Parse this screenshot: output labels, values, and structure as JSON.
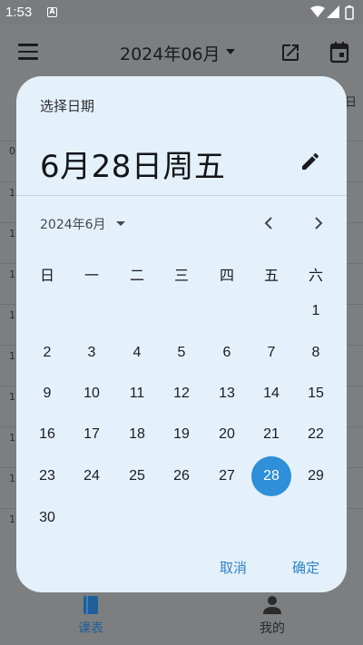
{
  "status_bar": {
    "time": "1:53",
    "app_badge": "A"
  },
  "app_bar": {
    "title": "2024年06月"
  },
  "background": {
    "side_text": "日",
    "row_numbers": [
      "0",
      "1",
      "1",
      "1",
      "1",
      "1",
      "1",
      "1",
      "1",
      "1"
    ]
  },
  "bottom_nav": {
    "schedule_label": "课表",
    "mine_label": "我的"
  },
  "dialog": {
    "label": "选择日期",
    "headline": "6月28日周五",
    "month_label": "2024年6月",
    "weekdays": [
      "日",
      "一",
      "二",
      "三",
      "四",
      "五",
      "六"
    ],
    "days": [
      "1",
      "2",
      "3",
      "4",
      "5",
      "6",
      "7",
      "8",
      "9",
      "10",
      "11",
      "12",
      "13",
      "14",
      "15",
      "16",
      "17",
      "18",
      "19",
      "20",
      "21",
      "22",
      "23",
      "24",
      "25",
      "26",
      "27",
      "28",
      "29",
      "30"
    ],
    "selected_day": "28",
    "cancel_label": "取消",
    "ok_label": "确定"
  },
  "colors": {
    "accent": "#2f8fd8",
    "dialog_bg": "#e4f1fb",
    "scrim": "#7d7e80"
  }
}
